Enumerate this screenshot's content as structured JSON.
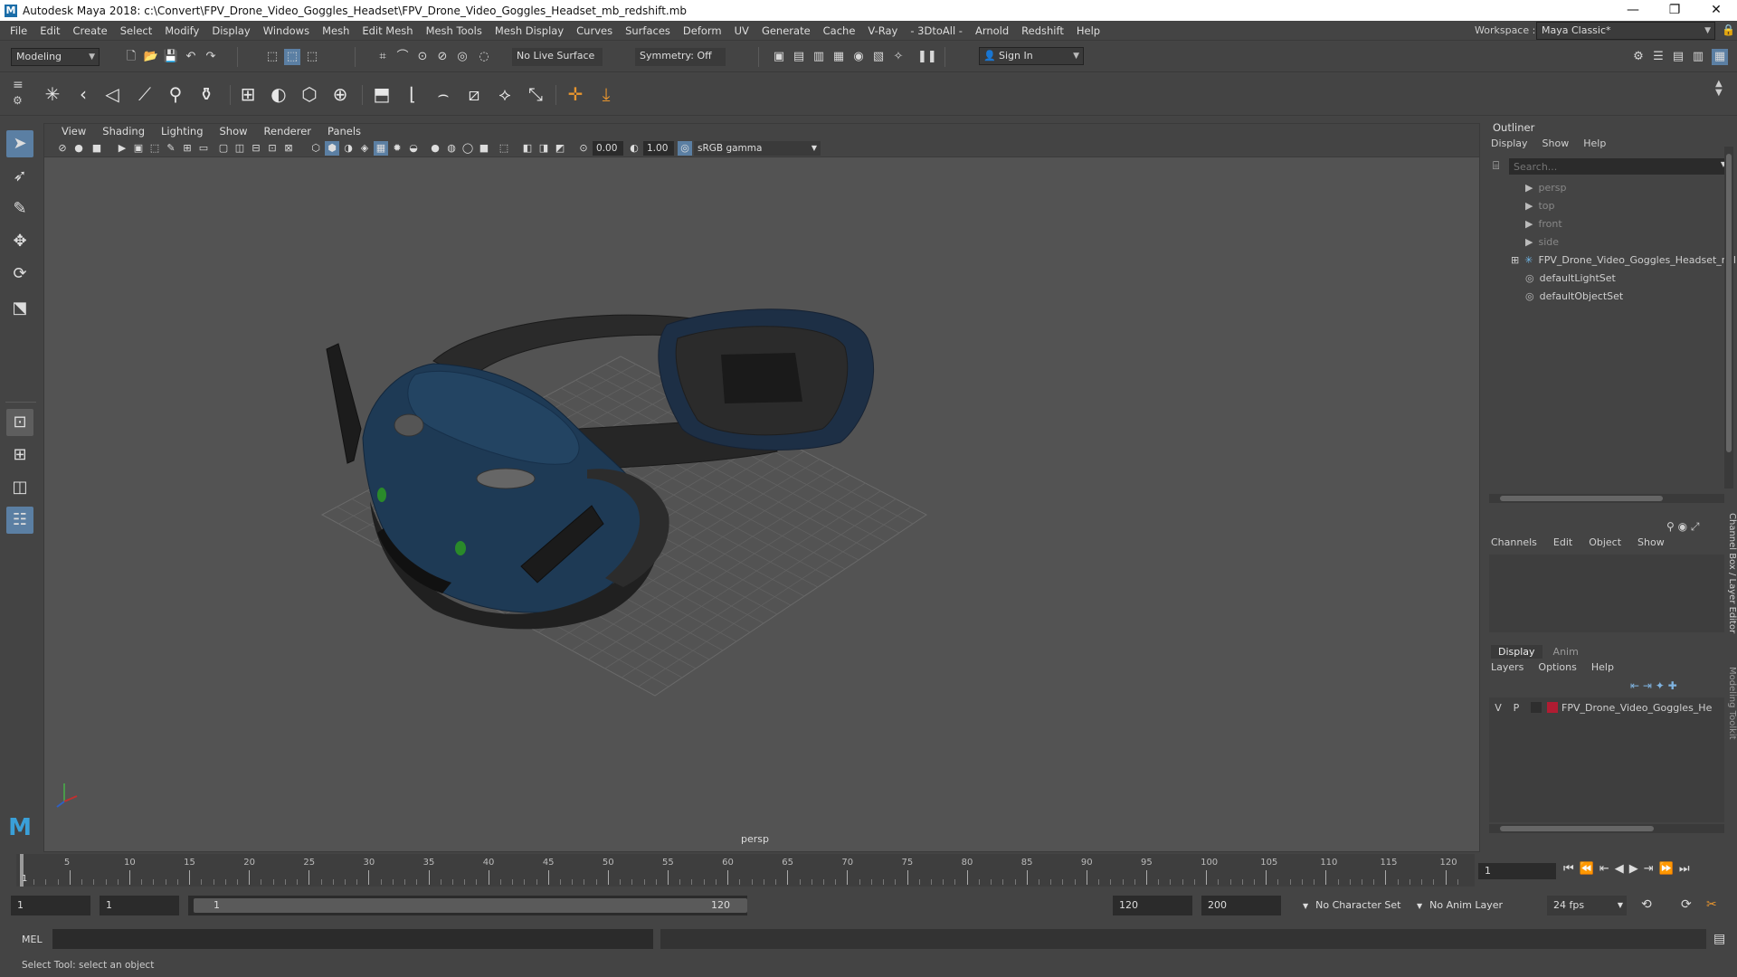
{
  "window": {
    "title": "Autodesk Maya 2018: c:\\Convert\\FPV_Drone_Video_Goggles_Headset\\FPV_Drone_Video_Goggles_Headset_mb_redshift.mb",
    "logo_letter": "M",
    "minimize": "—",
    "maximize": "❐",
    "close": "✕"
  },
  "menubar": {
    "items": [
      "File",
      "Edit",
      "Create",
      "Select",
      "Modify",
      "Display",
      "Windows",
      "Mesh",
      "Edit Mesh",
      "Mesh Tools",
      "Mesh Display",
      "Curves",
      "Surfaces",
      "Deform",
      "UV",
      "Generate",
      "Cache",
      "V-Ray",
      "- 3DtoAll -",
      "Arnold",
      "Redshift",
      "Help"
    ],
    "workspace_label": "Workspace :",
    "workspace_value": "Maya Classic*"
  },
  "statusline": {
    "mode": "Modeling",
    "live_surface": "No Live Surface",
    "symmetry": "Symmetry: Off",
    "sign_in": "Sign In"
  },
  "viewport": {
    "menu": [
      "View",
      "Shading",
      "Lighting",
      "Show",
      "Renderer",
      "Panels"
    ],
    "exposure": "0.00",
    "gamma": "1.00",
    "color_space": "sRGB gamma",
    "camera_label": "persp"
  },
  "outliner": {
    "title": "Outliner",
    "menu": [
      "Display",
      "Show",
      "Help"
    ],
    "search_placeholder": "Search...",
    "items": [
      {
        "label": "persp",
        "kind": "camera",
        "dim": true
      },
      {
        "label": "top",
        "kind": "camera",
        "dim": true
      },
      {
        "label": "front",
        "kind": "camera",
        "dim": true
      },
      {
        "label": "side",
        "kind": "camera",
        "dim": true
      },
      {
        "label": "FPV_Drone_Video_Goggles_Headset_ncl",
        "kind": "group",
        "dim": false
      },
      {
        "label": "defaultLightSet",
        "kind": "set",
        "dim": false
      },
      {
        "label": "defaultObjectSet",
        "kind": "set",
        "dim": false
      }
    ]
  },
  "channelbox": {
    "menu": [
      "Channels",
      "Edit",
      "Object",
      "Show"
    ],
    "side_tab_1": "Channel Box / Layer Editor",
    "side_tab_2": "Modeling Toolkit",
    "layer_tabs": [
      "Display",
      "Anim"
    ],
    "layer_menu": [
      "Layers",
      "Options",
      "Help"
    ],
    "layer": {
      "v": "V",
      "p": "P",
      "name": "FPV_Drone_Video_Goggles_He",
      "color": "#b01c32"
    }
  },
  "timeline": {
    "ticks": [
      "5",
      "10",
      "15",
      "20",
      "25",
      "30",
      "35",
      "40",
      "45",
      "50",
      "55",
      "60",
      "65",
      "70",
      "75",
      "80",
      "85",
      "90",
      "95",
      "100",
      "105",
      "110",
      "115",
      "120"
    ],
    "current_frame_marker": "1",
    "current_frame_field": "1"
  },
  "range": {
    "start": "1",
    "playback_start": "1",
    "slider_start": "1",
    "slider_end": "120",
    "playback_end": "120",
    "end": "200",
    "character_set": "No Character Set",
    "anim_layer": "No Anim Layer",
    "fps": "24 fps"
  },
  "cmdline": {
    "label": "MEL"
  },
  "helpline": {
    "text": "Select Tool: select an object"
  },
  "colors": {
    "goggle_blue": "#1e3a55",
    "strap": "#262626",
    "accent_green": "#2a8a2a"
  }
}
